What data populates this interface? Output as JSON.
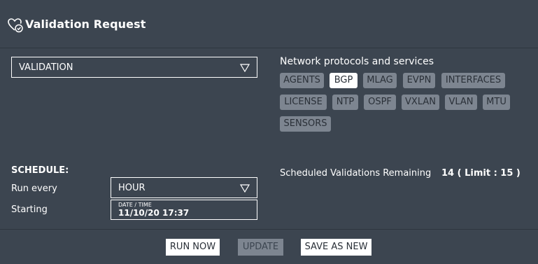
{
  "header": {
    "title": "Validation Request",
    "icon": "heart-check-icon"
  },
  "validation_select": {
    "value": "VALIDATION"
  },
  "protocols": {
    "label": "Network protocols and services",
    "items": [
      {
        "label": "AGENTS",
        "selected": false
      },
      {
        "label": "BGP",
        "selected": true
      },
      {
        "label": "MLAG",
        "selected": false
      },
      {
        "label": "EVPN",
        "selected": false
      },
      {
        "label": "INTERFACES",
        "selected": false
      },
      {
        "label": "LICENSE",
        "selected": false
      },
      {
        "label": "NTP",
        "selected": false
      },
      {
        "label": "OSPF",
        "selected": false
      },
      {
        "label": "VXLAN",
        "selected": false
      },
      {
        "label": "VLAN",
        "selected": false
      },
      {
        "label": "MTU",
        "selected": false
      },
      {
        "label": "SENSORS",
        "selected": false
      }
    ]
  },
  "schedule": {
    "heading": "SCHEDULE:",
    "run_every_label": "Run every",
    "run_every_value": "HOUR",
    "starting_label": "Starting",
    "date_caption": "DATE / TIME",
    "date_value": "11/10/20 17:37",
    "remaining_label": "Scheduled Validations Remaining",
    "remaining_value": "14 ( Limit : 15 )"
  },
  "actions": {
    "run_now": "RUN NOW",
    "update": "UPDATE",
    "save_as_new": "SAVE AS NEW"
  }
}
